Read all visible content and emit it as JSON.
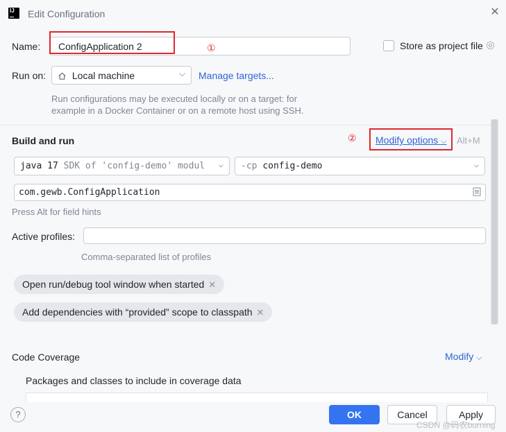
{
  "window": {
    "app_icon_text": "IJ",
    "title": "Edit Configuration"
  },
  "name_row": {
    "label": "Name:",
    "value": "ConfigApplication 2",
    "annotation": "①",
    "store_label": "Store as project file",
    "store_checked": false
  },
  "run_on": {
    "label": "Run on:",
    "target": "Local machine",
    "manage_link": "Manage targets...",
    "hint_line1": "Run configurations may be executed locally or on a target: for",
    "hint_line2": "example in a Docker Container or on a remote host using SSH."
  },
  "build_run": {
    "title": "Build and run",
    "annotation": "②",
    "modify_label": "Modify options",
    "shortcut": "Alt+M",
    "jdk_name": "java 17",
    "jdk_detail": "SDK of 'config-demo' modul",
    "cp_prefix": "-cp",
    "cp_value": "config-demo",
    "main_class": "com.gewb.ConfigApplication",
    "field_hint": "Press Alt for field hints"
  },
  "profiles": {
    "label": "Active profiles:",
    "value": "",
    "hint": "Comma-separated list of profiles"
  },
  "chips": [
    {
      "label": "Open run/debug tool window when started"
    },
    {
      "label": "Add dependencies with “provided” scope to classpath"
    }
  ],
  "coverage": {
    "title": "Code Coverage",
    "modify_label": "Modify",
    "packages_label": "Packages and classes to include in coverage data"
  },
  "buttons": {
    "ok": "OK",
    "cancel": "Cancel",
    "apply": "Apply",
    "help": "?"
  },
  "watermark": "CSDN @码农burning",
  "colors": {
    "accent": "#3574f0",
    "link": "#2f64d6",
    "annotation_red": "#e0262c",
    "background": "#f7f8fa"
  }
}
